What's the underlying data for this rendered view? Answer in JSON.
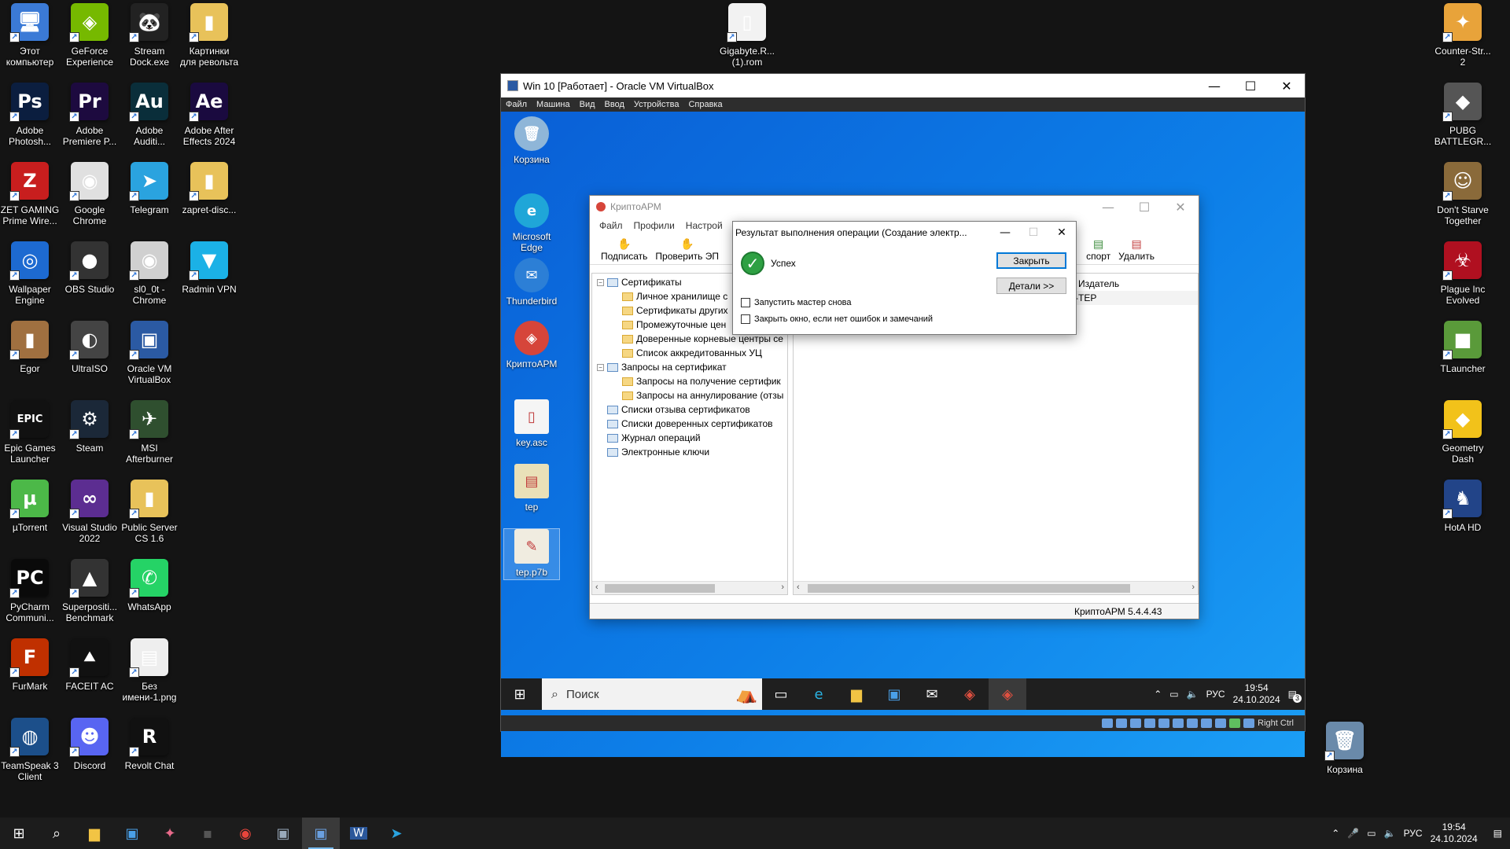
{
  "desktop": {
    "icons": [
      {
        "label": "Этот\nкомпьютер",
        "glyph": "🖥",
        "bg": "#3b7ad6"
      },
      {
        "label": "GeForce\nExperience",
        "glyph": "◈",
        "bg": "#76b900"
      },
      {
        "label": "Stream\nDock.exe",
        "glyph": "🐼",
        "bg": "#222222"
      },
      {
        "label": "Картинки\nдля револьта",
        "glyph": "▮",
        "bg": "#e8c25a"
      },
      {
        "label": "Adobe\nPhotosh...",
        "glyph": "Ps",
        "bg": "#0b1e3f"
      },
      {
        "label": "Adobe\nPremiere P...",
        "glyph": "Pr",
        "bg": "#1d0a3f"
      },
      {
        "label": "Adobe\nAuditi...",
        "glyph": "Au",
        "bg": "#0a2e3a"
      },
      {
        "label": "Adobe After\nEffects 2024",
        "glyph": "Ae",
        "bg": "#1a0a3f"
      },
      {
        "label": "ZET GAMING\nPrime Wire...",
        "glyph": "Z",
        "bg": "#c81e1e"
      },
      {
        "label": "Google\nChrome",
        "glyph": "◉",
        "bg": "#e0e0e0"
      },
      {
        "label": "Telegram",
        "glyph": "➤",
        "bg": "#2aa3df"
      },
      {
        "label": "zapret-disc...",
        "glyph": "▮",
        "bg": "#e8c25a"
      },
      {
        "label": "Wallpaper\nEngine",
        "glyph": "◎",
        "bg": "#1d6ad1"
      },
      {
        "label": "OBS Studio",
        "glyph": "●",
        "bg": "#333333"
      },
      {
        "label": "sl0_0t -\nChrome",
        "glyph": "◉",
        "bg": "#d0d0d0"
      },
      {
        "label": "Radmin VPN",
        "glyph": "▼",
        "bg": "#1bb1e6"
      },
      {
        "label": "Egor",
        "glyph": "▮",
        "bg": "#a07040"
      },
      {
        "label": "UltraISO",
        "glyph": "◐",
        "bg": "#444444"
      },
      {
        "label": "Oracle VM\nVirtualBox",
        "glyph": "▣",
        "bg": "#2b5aa3"
      },
      {
        "label": "Epic Games\nLauncher",
        "glyph": "EPIC",
        "bg": "#111111"
      },
      {
        "label": "Steam",
        "glyph": "⚙",
        "bg": "#1b2838"
      },
      {
        "label": "MSI\nAfterburner",
        "glyph": "✈",
        "bg": "#2f4f2f"
      },
      {
        "label": "µTorrent",
        "glyph": "µ",
        "bg": "#4cb848"
      },
      {
        "label": "Visual Studio\n2022",
        "glyph": "∞",
        "bg": "#5c2d91"
      },
      {
        "label": "Public Server\nCS 1.6",
        "glyph": "▮",
        "bg": "#e8c25a"
      },
      {
        "label": "PyCharm\nCommuni...",
        "glyph": "PC",
        "bg": "#0a0a0a"
      },
      {
        "label": "Superpositi...\nBenchmark",
        "glyph": "▲",
        "bg": "#333333"
      },
      {
        "label": "WhatsApp",
        "glyph": "✆",
        "bg": "#25d366"
      },
      {
        "label": "FurMark",
        "glyph": "F",
        "bg": "#c03000"
      },
      {
        "label": "FACEIT AC",
        "glyph": "⯅",
        "bg": "#111111"
      },
      {
        "label": "Без\nимени-1.png",
        "glyph": "▤",
        "bg": "#eeeeee"
      },
      {
        "label": "TeamSpeak 3\nClient",
        "glyph": "◍",
        "bg": "#1c4f8a"
      },
      {
        "label": "Discord",
        "glyph": "☻",
        "bg": "#5865f2"
      },
      {
        "label": "Revolt Chat",
        "glyph": "R",
        "bg": "#111111"
      },
      {
        "label": "Gigabyte.R...\n(1).rom",
        "glyph": "▯",
        "bg": "#f2f2f2"
      },
      {
        "label": "Counter-Str...\n2",
        "glyph": "✦",
        "bg": "#e8a33a"
      },
      {
        "label": "PUBG\nBATTLEGR...",
        "glyph": "◆",
        "bg": "#555555"
      },
      {
        "label": "Don't Starve\nTogether",
        "glyph": "☺",
        "bg": "#8a6a3a"
      },
      {
        "label": "Plague Inc\nEvolved",
        "glyph": "☣",
        "bg": "#b01020"
      },
      {
        "label": "TLauncher",
        "glyph": "■",
        "bg": "#5a9a3a"
      },
      {
        "label": "Geometry\nDash",
        "glyph": "◆",
        "bg": "#f2c21a"
      },
      {
        "label": "HotA HD",
        "glyph": "♞",
        "bg": "#224488"
      },
      {
        "label": "Корзина",
        "glyph": "🗑",
        "bg": "#6a8aaa"
      }
    ]
  },
  "vbox": {
    "title": "Win 10 [Работает] - Oracle VM VirtualBox",
    "menu": [
      "Файл",
      "Машина",
      "Вид",
      "Ввод",
      "Устройства",
      "Справка"
    ],
    "status_hostkey": "Right Ctrl"
  },
  "guest": {
    "icons": [
      {
        "label": "Корзина",
        "glyph": "🗑",
        "bg": "#8fb6d8"
      },
      {
        "label": "Microsoft\nEdge",
        "glyph": "e",
        "bg": "#1fa6d8"
      },
      {
        "label": "Thunderbird",
        "glyph": "✉",
        "bg": "#2c7fd6"
      },
      {
        "label": "КриптоАРМ",
        "glyph": "◈",
        "bg": "#d6453a"
      },
      {
        "label": "key.asc",
        "glyph": "▯",
        "bg": "#f5f5f5"
      },
      {
        "label": "tep",
        "glyph": "▤",
        "bg": "#e9e0b8"
      },
      {
        "label": "tep.p7b",
        "glyph": "✎",
        "bg": "#f0ece0"
      }
    ],
    "search_placeholder": "Поиск",
    "clock_time": "19:54",
    "clock_date": "24.10.2024",
    "lang": "РУС",
    "notif_count": "3"
  },
  "cryptoarm": {
    "title": "КриптоАРМ",
    "menu": [
      "Файл",
      "Профили",
      "Настрой"
    ],
    "toolbar": {
      "sign": "Подписать",
      "verify": "Проверить ЭП",
      "export": "спорт",
      "delete": "Удалить"
    },
    "tree": [
      {
        "label": "Сертификаты",
        "level": 0,
        "type": "cert",
        "expander": "−"
      },
      {
        "label": "Личное хранилище с",
        "level": 1,
        "type": "folder"
      },
      {
        "label": "Сертификаты других",
        "level": 1,
        "type": "folder"
      },
      {
        "label": "Промежуточные цен",
        "level": 1,
        "type": "folder"
      },
      {
        "label": "Доверенные корневые центры се",
        "level": 1,
        "type": "folder"
      },
      {
        "label": "Список аккредитованных УЦ",
        "level": 1,
        "type": "folder"
      },
      {
        "label": "Запросы на сертификат",
        "level": 0,
        "type": "cert",
        "expander": "−"
      },
      {
        "label": "Запросы на получение сертифик",
        "level": 1,
        "type": "folder"
      },
      {
        "label": "Запросы на аннулирование (отзы",
        "level": 1,
        "type": "folder"
      },
      {
        "label": "Списки отзыва сертификатов",
        "level": 0,
        "type": "cert"
      },
      {
        "label": "Списки доверенных сертификатов",
        "level": 0,
        "type": "cert"
      },
      {
        "label": "Журнал операций",
        "level": 0,
        "type": "cert"
      },
      {
        "label": "Электронные ключи",
        "level": 0,
        "type": "cert"
      }
    ],
    "list_header": "Издатель",
    "list_row": "-TEP",
    "status": "КриптоАРМ 5.4.4.43"
  },
  "dialog": {
    "title": "Результат выполнения операции (Создание электр...",
    "result": "Успех",
    "close_btn": "Закрыть",
    "details_btn": "Детали >>",
    "chk_rerun": "Запустить мастер снова",
    "chk_close": "Закрыть окно, если нет ошибок и замечаний"
  },
  "taskbar": {
    "lang": "РУС",
    "clock_time": "19:54",
    "clock_date": "24.10.2024"
  }
}
